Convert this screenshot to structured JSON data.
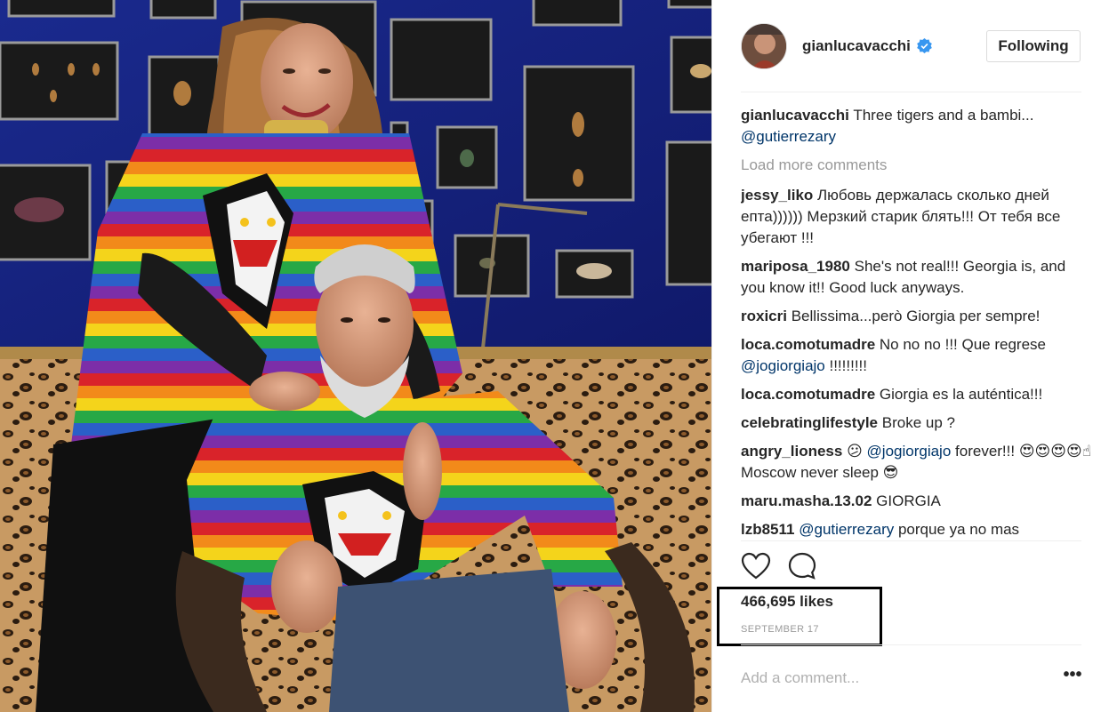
{
  "post": {
    "username": "gianlucavacchi",
    "follow_label": "Following",
    "caption_text": "Three tigers and a bambi...",
    "caption_mention": "@gutierrezary",
    "load_more": "Load more comments",
    "likes": "466,695 likes",
    "date": "SEPTEMBER 17",
    "add_comment_placeholder": "Add a comment...",
    "more_options": "•••"
  },
  "comments": [
    {
      "user": "jessy_liko",
      "text": "Любовь держалась сколько дней епта)))))) Мерзкий старик блять!!! От тебя все убегают !!!"
    },
    {
      "user": "mariposa_1980",
      "text": "She's not real!!! Georgia is, and you know it!! Good luck anyways."
    },
    {
      "user": "roxicri",
      "text": "Bellissima...però Giorgia per sempre!"
    },
    {
      "user": "loca.comotumadre",
      "text": "No no no !!! Que regrese",
      "mention": "@jogiorgiajo",
      "after": " !!!!!!!!!"
    },
    {
      "user": "loca.comotumadre",
      "text": "Giorgia es la auténtica!!!"
    },
    {
      "user": "celebratinglifestyle",
      "text": "Broke up ?"
    },
    {
      "user": "angry_lioness",
      "text": "😕",
      "mention": "@jogiorgiajo",
      "after": " forever!!! 😍😍😍😍☝Moscow never sleep 😎"
    },
    {
      "user": "maru.masha.13.02",
      "text": "GIORGIA"
    },
    {
      "user": "lzb8511",
      "text": "",
      "mention": "@gutierrezary",
      "after": " porque ya no mas"
    }
  ],
  "icons": {
    "verified": "verified-badge-icon",
    "like": "heart-icon",
    "comment": "comment-bubble-icon"
  },
  "colors": {
    "mention": "#003569",
    "verified": "#3897f0",
    "wall": "#1b2a8c"
  }
}
